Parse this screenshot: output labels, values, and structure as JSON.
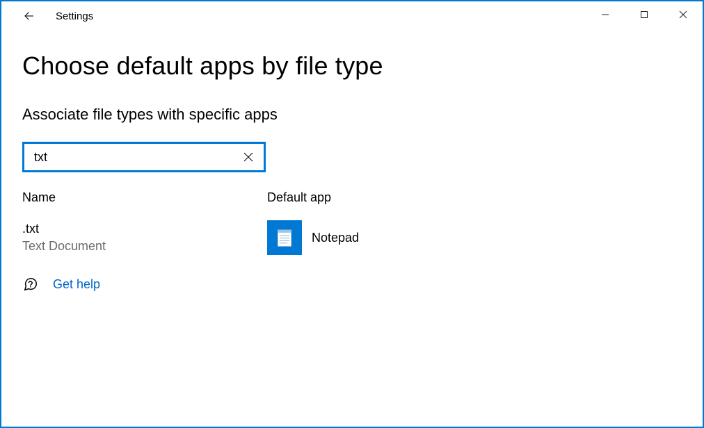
{
  "window": {
    "title": "Settings"
  },
  "page": {
    "heading": "Choose default apps by file type",
    "sub_heading": "Associate file types with specific apps"
  },
  "search": {
    "value": "txt"
  },
  "columns": {
    "name": "Name",
    "default_app": "Default app"
  },
  "rows": [
    {
      "extension": ".txt",
      "description": "Text Document",
      "app_name": "Notepad"
    }
  ],
  "help": {
    "label": "Get help"
  }
}
